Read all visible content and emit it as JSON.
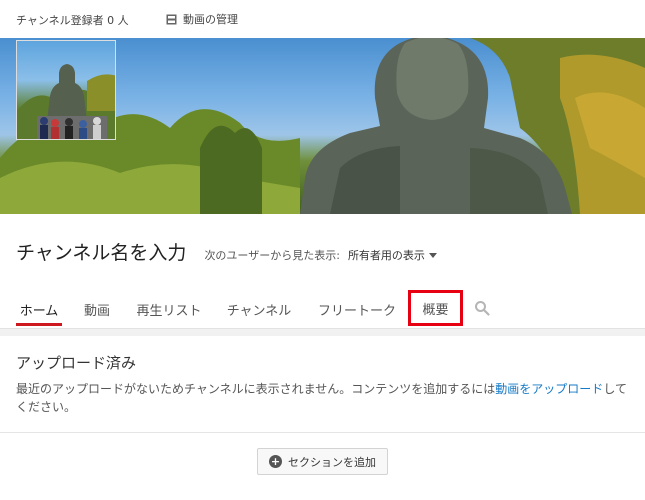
{
  "header": {
    "subscribers": "チャンネル登録者 0 人",
    "manage_videos": "動画の管理"
  },
  "channel": {
    "title": "チャンネル名を入力",
    "view_as_label": "次のユーザーから見た表示:",
    "view_as_value": "所有者用の表示"
  },
  "tabs": [
    {
      "label": "ホーム",
      "active": true
    },
    {
      "label": "動画"
    },
    {
      "label": "再生リスト"
    },
    {
      "label": "チャンネル"
    },
    {
      "label": "フリートーク"
    },
    {
      "label": "概要",
      "highlighted": true
    }
  ],
  "section": {
    "title": "アップロード済み",
    "desc_before": "最近のアップロードがないためチャンネルに表示されません。コンテンツを追加するには",
    "desc_link": "動画をアップロード",
    "desc_after": "してください。"
  },
  "add_section_label": "セクションを追加",
  "colors": {
    "accent_red": "#cc181e",
    "highlight_red": "#e60012",
    "link_blue": "#167ac6"
  }
}
